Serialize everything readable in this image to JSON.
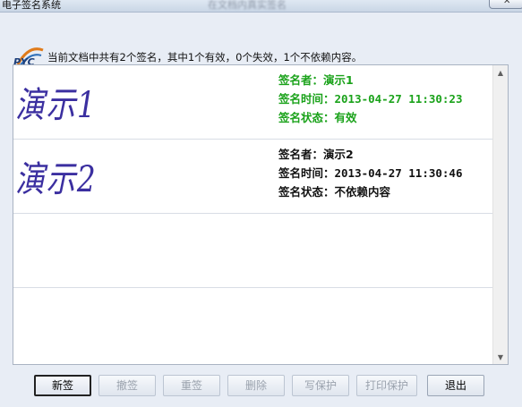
{
  "window": {
    "title": "电子签名系统",
    "title_obscured": "在文档内真实签名"
  },
  "header": {
    "logo_text": "PYC",
    "message": "当前文档中共有2个签名，其中1个有效，0个失效，1个不依赖内容。"
  },
  "signatures": [
    {
      "image_text": "演示1",
      "signer_line": "签名者：演示1",
      "time_line": "签名时间：2013-04-27 11:30:23",
      "status_line": "签名状态：有效",
      "status_color": "#1aa21a"
    },
    {
      "image_text": "演示2",
      "signer_line": "签名者：演示2",
      "time_line": "签名时间：2013-04-27 11:30:46",
      "status_line": "签名状态：不依赖内容",
      "status_color": "#111111"
    }
  ],
  "buttons": {
    "new_sign": "新签",
    "revoke": "撤签",
    "resign": "重签",
    "delete": "删除",
    "write_protect": "写保护",
    "print_protect": "打印保护",
    "exit": "退出"
  }
}
